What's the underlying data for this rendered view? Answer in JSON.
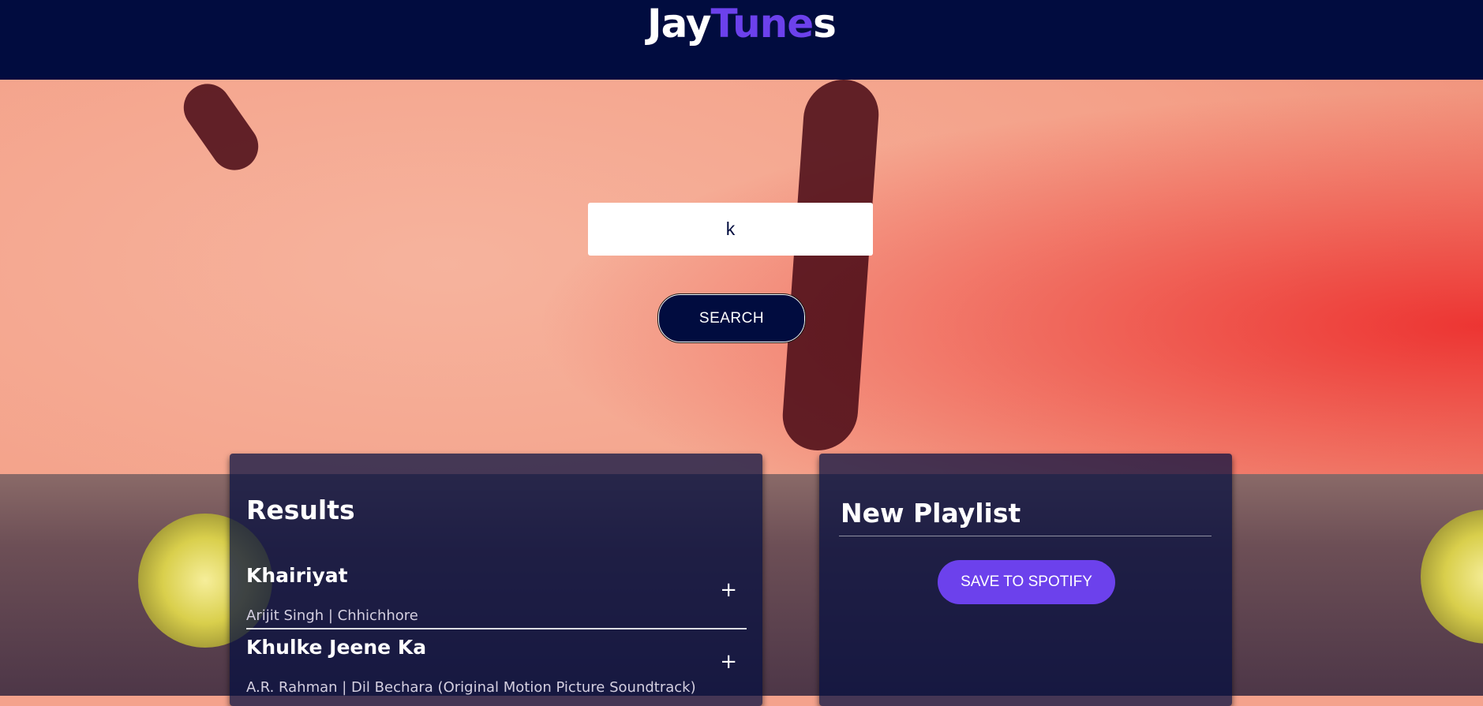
{
  "brand": {
    "part1": "Jay",
    "part2": "Tune",
    "part3": "s",
    "accent_color": "#6c41ec",
    "header_color": "#010c3f"
  },
  "search": {
    "value": "k",
    "button_label": "SEARCH"
  },
  "results": {
    "title": "Results",
    "tracks": [
      {
        "name": "Khairiyat",
        "meta": "Arijit Singh | Chhichhore",
        "action": "+"
      },
      {
        "name": "Khulke Jeene Ka",
        "meta": "A.R. Rahman | Dil Bechara (Original Motion Picture Soundtrack)",
        "action": "+"
      }
    ]
  },
  "playlist": {
    "title": "New Playlist",
    "save_label": "SAVE TO SPOTIFY"
  }
}
